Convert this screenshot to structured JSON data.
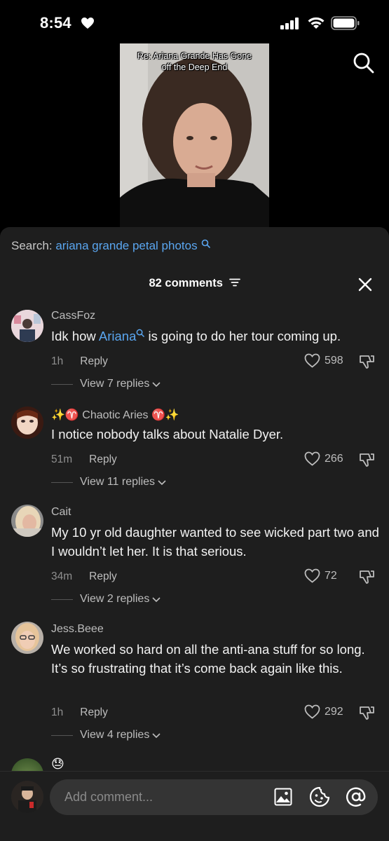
{
  "status_bar": {
    "time": "8:54"
  },
  "video": {
    "caption_line1": "Re: Ariana Grande Has Gone",
    "caption_line2": "off the Deep End"
  },
  "search_suggestion": {
    "prefix": "Search:",
    "query": "ariana grande petal photos"
  },
  "comments_header": {
    "count_label": "82 comments"
  },
  "comments": [
    {
      "username": "CassFoz",
      "text_before": "Idk how ",
      "link": "Ariana",
      "text_after": " is going to do her tour coming up.",
      "time": "1h",
      "reply_label": "Reply",
      "likes": "598",
      "view_replies": "View 7 replies"
    },
    {
      "username": "✨♈️ Chaotic Aries ♈️✨",
      "text": "I notice nobody talks about Natalie Dyer.",
      "time": "51m",
      "reply_label": "Reply",
      "likes": "266",
      "view_replies": "View 11 replies"
    },
    {
      "username": "Cait",
      "text": "My 10 yr old daughter wanted to see wicked part two and I wouldn’t let her. It is that serious.",
      "time": "34m",
      "reply_label": "Reply",
      "likes": "72",
      "view_replies": "View 2 replies"
    },
    {
      "username": "Jess.Beee",
      "text": "We worked so hard on all the anti-ana stuff for so long. It’s so frustrating that it’s come back again like this.",
      "time": "1h",
      "reply_label": "Reply",
      "likes": "292",
      "view_replies": "View 4 replies"
    }
  ],
  "partial_comment": {
    "text": "😓"
  },
  "comment_input": {
    "placeholder": "Add comment..."
  },
  "colors": {
    "sheet_bg": "#1e1e1e",
    "link_blue": "#5aa6f0",
    "input_bg": "#343434"
  }
}
